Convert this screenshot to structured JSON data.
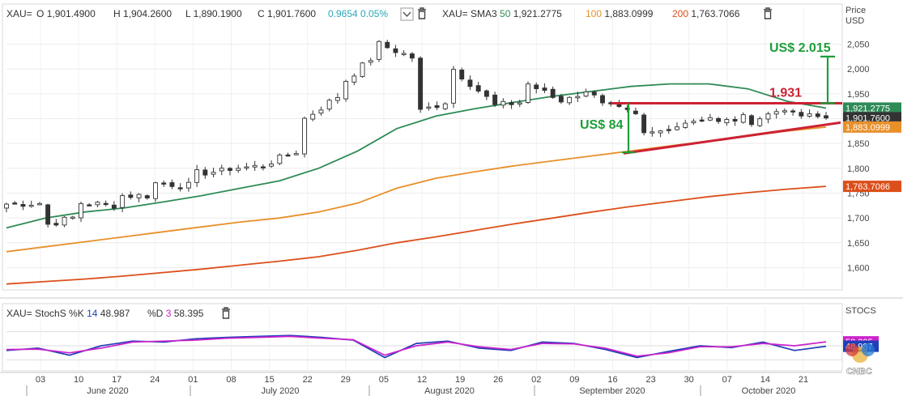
{
  "ticker": "XAU=",
  "colors": {
    "sma50": "#2e8b57",
    "sma100": "#e8902a",
    "sma200": "#dc4f1a",
    "candle_up": "#ffffff",
    "candle_down": "#333333",
    "stoch_k": "#1f3fb8",
    "stoch_d": "#cc22cc",
    "annotation_green": "#1e9e3a",
    "annotation_red": "#cc2233"
  },
  "header": {
    "ohlc": [
      {
        "key": "O",
        "value": "1,901.4900"
      },
      {
        "key": "H",
        "value": "1,904.2600"
      },
      {
        "key": "L",
        "value": "1,890.1900"
      },
      {
        "key": "C",
        "value": "1,901.7600"
      }
    ],
    "change": "0.9654",
    "change_pct": "0.05%",
    "sma_label": "XAU= SMA3",
    "sma": [
      {
        "period": "50",
        "value": "1,921.2775",
        "color": "#2e8b57"
      },
      {
        "period": "100",
        "value": "1,883.0999",
        "color": "#e8902a"
      },
      {
        "period": "200",
        "value": "1,763.7066",
        "color": "#dc4f1a"
      }
    ],
    "stoch_label": "XAU= StochS %K",
    "stoch_k_period": "14",
    "stoch_k_value": "48.987",
    "stoch_d_label": "%D",
    "stoch_d_period": "3",
    "stoch_d_value": "58.395"
  },
  "price_axis": {
    "title": "Price",
    "unit": "USD",
    "ticks": [
      "2,050",
      "2,000",
      "1,950",
      "1,900",
      "1,850",
      "1,800",
      "1,750",
      "1,700",
      "1,650",
      "1,600"
    ],
    "badges": [
      {
        "value": "1,921.2775",
        "color": "#2e8b57"
      },
      {
        "value": "1,901.7600",
        "color": "#333333"
      },
      {
        "value": "1,883.0999",
        "color": "#e8902a"
      },
      {
        "value": "1,763.7066",
        "color": "#dc4f1a"
      }
    ]
  },
  "stoch_axis": {
    "title": "STOCS",
    "badges": [
      {
        "value": "58.395",
        "color": "#cc22cc"
      },
      {
        "value": "48.987",
        "color": "#1f3fb8"
      }
    ]
  },
  "annotations": {
    "top_gap": "US$ 2.015",
    "resistance": "1.931",
    "bottom_gap": "US$ 84"
  },
  "x_axis": {
    "day_ticks": [
      "03",
      "10",
      "17",
      "24",
      "01",
      "08",
      "15",
      "22",
      "29",
      "05",
      "12",
      "19",
      "26",
      "02",
      "09",
      "16",
      "23",
      "30",
      "07",
      "14",
      "21"
    ],
    "months": [
      "June 2020",
      "July 2020",
      "August 2020",
      "September 2020",
      "October 2020"
    ]
  },
  "watermark": "CNBC",
  "chart_data": [
    {
      "type": "candlestick",
      "title": "XAU= daily",
      "unit": "USD",
      "ylim": [
        1560,
        2090
      ],
      "ohlc_approx": [
        {
          "x": "2020-05-29",
          "o": 1710,
          "c": 1728
        },
        {
          "x": "2020-06-05",
          "o": 1730,
          "c": 1685
        },
        {
          "x": "2020-06-12",
          "o": 1705,
          "c": 1730
        },
        {
          "x": "2020-06-19",
          "o": 1725,
          "c": 1745
        },
        {
          "x": "2020-06-26",
          "o": 1745,
          "c": 1770
        },
        {
          "x": "2020-07-03",
          "o": 1765,
          "c": 1790
        },
        {
          "x": "2020-07-10",
          "o": 1795,
          "c": 1800
        },
        {
          "x": "2020-07-17",
          "o": 1805,
          "c": 1810
        },
        {
          "x": "2020-07-24",
          "o": 1840,
          "c": 1900
        },
        {
          "x": "2020-07-31",
          "o": 1950,
          "c": 1970
        },
        {
          "x": "2020-08-06",
          "o": 2035,
          "c": 2050
        },
        {
          "x": "2020-08-11",
          "o": 2020,
          "c": 1912
        },
        {
          "x": "2020-08-18",
          "o": 1940,
          "c": 2000
        },
        {
          "x": "2020-08-25",
          "o": 1935,
          "c": 1925
        },
        {
          "x": "2020-09-01",
          "o": 1935,
          "c": 1970
        },
        {
          "x": "2020-09-08",
          "o": 1930,
          "c": 1945
        },
        {
          "x": "2020-09-15",
          "o": 1955,
          "c": 1935
        },
        {
          "x": "2020-09-22",
          "o": 1900,
          "c": 1865
        },
        {
          "x": "2020-09-29",
          "o": 1880,
          "c": 1890
        },
        {
          "x": "2020-10-06",
          "o": 1905,
          "c": 1890
        },
        {
          "x": "2020-10-13",
          "o": 1905,
          "c": 1895
        },
        {
          "x": "2020-10-21",
          "o": 1925,
          "c": 1908
        },
        {
          "x": "2020-10-23",
          "o": 1901.49,
          "h": 1904.26,
          "l": 1890.19,
          "c": 1901.76
        }
      ],
      "series": [
        {
          "name": "SMA 50",
          "last": 1921.2775,
          "values_approx": [
            1680,
            1700,
            1712,
            1720,
            1732,
            1745,
            1760,
            1775,
            1800,
            1835,
            1880,
            1905,
            1920,
            1933,
            1945,
            1955,
            1965,
            1970,
            1970,
            1960,
            1935,
            1921.2775
          ]
        },
        {
          "name": "SMA 100",
          "last": 1883.0999,
          "values_approx": [
            1632,
            1642,
            1652,
            1662,
            1672,
            1682,
            1692,
            1700,
            1712,
            1730,
            1760,
            1780,
            1793,
            1805,
            1815,
            1825,
            1835,
            1845,
            1855,
            1865,
            1875,
            1883.0999
          ]
        },
        {
          "name": "SMA 200",
          "last": 1763.7066,
          "values_approx": [
            1567,
            1572,
            1577,
            1583,
            1590,
            1597,
            1605,
            1613,
            1622,
            1635,
            1650,
            1662,
            1675,
            1688,
            1700,
            1712,
            1723,
            1733,
            1743,
            1751,
            1758,
            1763.7066
          ]
        }
      ]
    },
    {
      "type": "line",
      "title": "Stochastic %K 14 %D 3",
      "ylim": [
        0,
        100
      ],
      "series": [
        {
          "name": "%K",
          "last": 48.987,
          "values_approx": [
            40,
            45,
            30,
            50,
            60,
            58,
            65,
            68,
            70,
            72,
            68,
            62,
            25,
            55,
            60,
            45,
            40,
            58,
            55,
            42,
            25,
            38,
            50,
            46,
            58,
            40,
            48.987
          ]
        },
        {
          "name": "%D",
          "last": 58.395,
          "values_approx": [
            42,
            43,
            35,
            45,
            58,
            60,
            62,
            66,
            68,
            70,
            66,
            63,
            30,
            50,
            58,
            48,
            42,
            55,
            54,
            45,
            28,
            35,
            48,
            48,
            55,
            50,
            58.395
          ]
        }
      ]
    }
  ]
}
